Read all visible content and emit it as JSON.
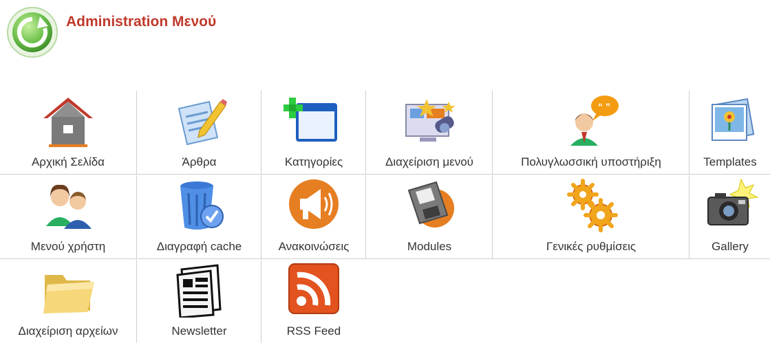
{
  "header": {
    "title": "Administration Μενού",
    "logo": "refresh-icon"
  },
  "row1": [
    {
      "label": "Αρχική Σελίδα",
      "icon": "home-icon"
    },
    {
      "label": "Άρθρα",
      "icon": "article-edit-icon"
    },
    {
      "label": "Κατηγορίες",
      "icon": "new-window-icon"
    },
    {
      "label": "Διαχείριση μενού",
      "icon": "menu-manager-icon"
    },
    {
      "label": "Πολυγλωσσική υποστήριξη",
      "icon": "multilingual-icon"
    },
    {
      "label": "Templates",
      "icon": "templates-icon"
    }
  ],
  "row2": [
    {
      "label": "Μενού χρήστη",
      "icon": "users-icon"
    },
    {
      "label": "Διαγραφή cache",
      "icon": "recycle-bin-icon"
    },
    {
      "label": "Ανακοινώσεις",
      "icon": "megaphone-icon"
    },
    {
      "label": "Modules",
      "icon": "floppy-disk-icon"
    },
    {
      "label": "Γενικές ρυθμίσεις",
      "icon": "gears-icon"
    },
    {
      "label": "Gallery",
      "icon": "camera-icon"
    }
  ],
  "row3": [
    {
      "label": "Διαχείριση αρχείων",
      "icon": "folder-icon"
    },
    {
      "label": "Newsletter",
      "icon": "newspaper-icon"
    },
    {
      "label": "RSS Feed",
      "icon": "rss-icon"
    }
  ],
  "colors": {
    "title": "#c0392b",
    "divider": "#cfcfcf",
    "label": "#333333"
  }
}
